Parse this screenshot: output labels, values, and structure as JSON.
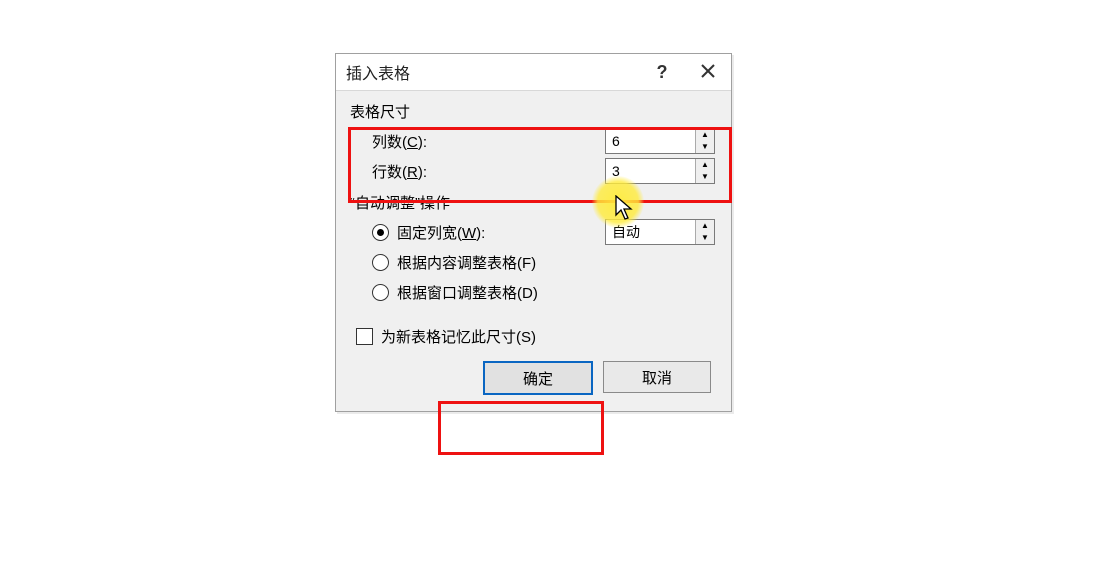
{
  "titlebar": {
    "title": "插入表格",
    "help": "?",
    "close": "×"
  },
  "section_size": {
    "label": "表格尺寸",
    "columns_label_pre": "列数(",
    "columns_hotkey": "C",
    "columns_label_post": "):",
    "columns_value": "6",
    "rows_label_pre": "行数(",
    "rows_hotkey": "R",
    "rows_label_post": "):",
    "rows_value": "3"
  },
  "section_autofit": {
    "label": "“自动调整”操作",
    "fixed_pre": "固定列宽(",
    "fixed_hotkey": "W",
    "fixed_post": "):",
    "fixed_value": "自动",
    "fit_content_pre": "根据内容调整表格(",
    "fit_content_hotkey": "F",
    "fit_content_post": ")",
    "fit_window_pre": "根据窗口调整表格(",
    "fit_window_hotkey": "D",
    "fit_window_post": ")",
    "selected": "fixed"
  },
  "remember": {
    "label_pre": "为新表格记忆此尺寸(",
    "label_hotkey": "S",
    "label_post": ")",
    "checked": false
  },
  "buttons": {
    "ok": "确定",
    "cancel": "取消"
  }
}
